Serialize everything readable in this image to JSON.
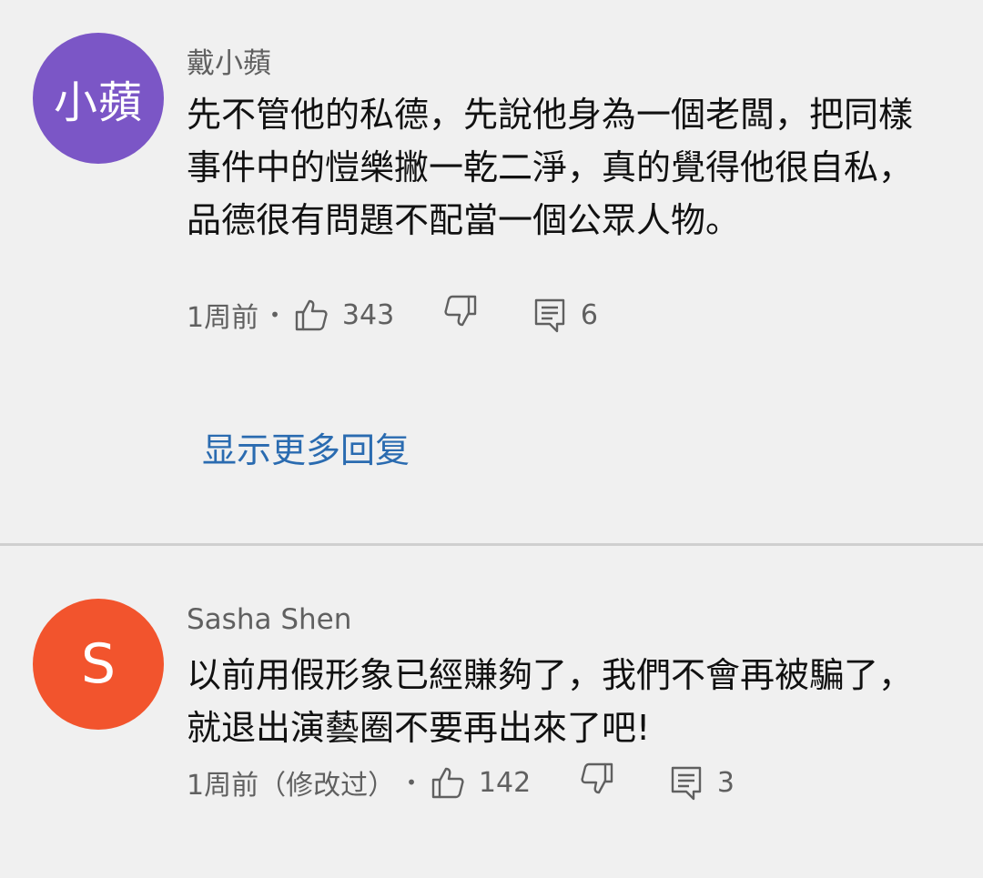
{
  "comments": [
    {
      "avatar_text": "小蘋",
      "avatar_color": "#7b56c6",
      "author": "戴小蘋",
      "text": "先不管他的私德，先說他身為一個老闆，把同樣事件中的愷樂撇一乾二淨，真的覺得他很自私，品德很有問題不配當一個公眾人物。",
      "time": "1周前",
      "likes": "343",
      "replies": "6"
    },
    {
      "avatar_text": "S",
      "avatar_color": "#f2542d",
      "author": "Sasha Shen",
      "text": "以前用假形象已經賺夠了，我們不會再被騙了，就退出演藝圈不要再出來了吧!",
      "time": "1周前（修改过）",
      "likes": "142",
      "replies": "3"
    }
  ],
  "meta_separator": "•",
  "show_more_replies": "显示更多回复",
  "icons": {
    "like": "thumbs-up-icon",
    "dislike": "thumbs-down-icon",
    "reply": "comment-icon"
  }
}
